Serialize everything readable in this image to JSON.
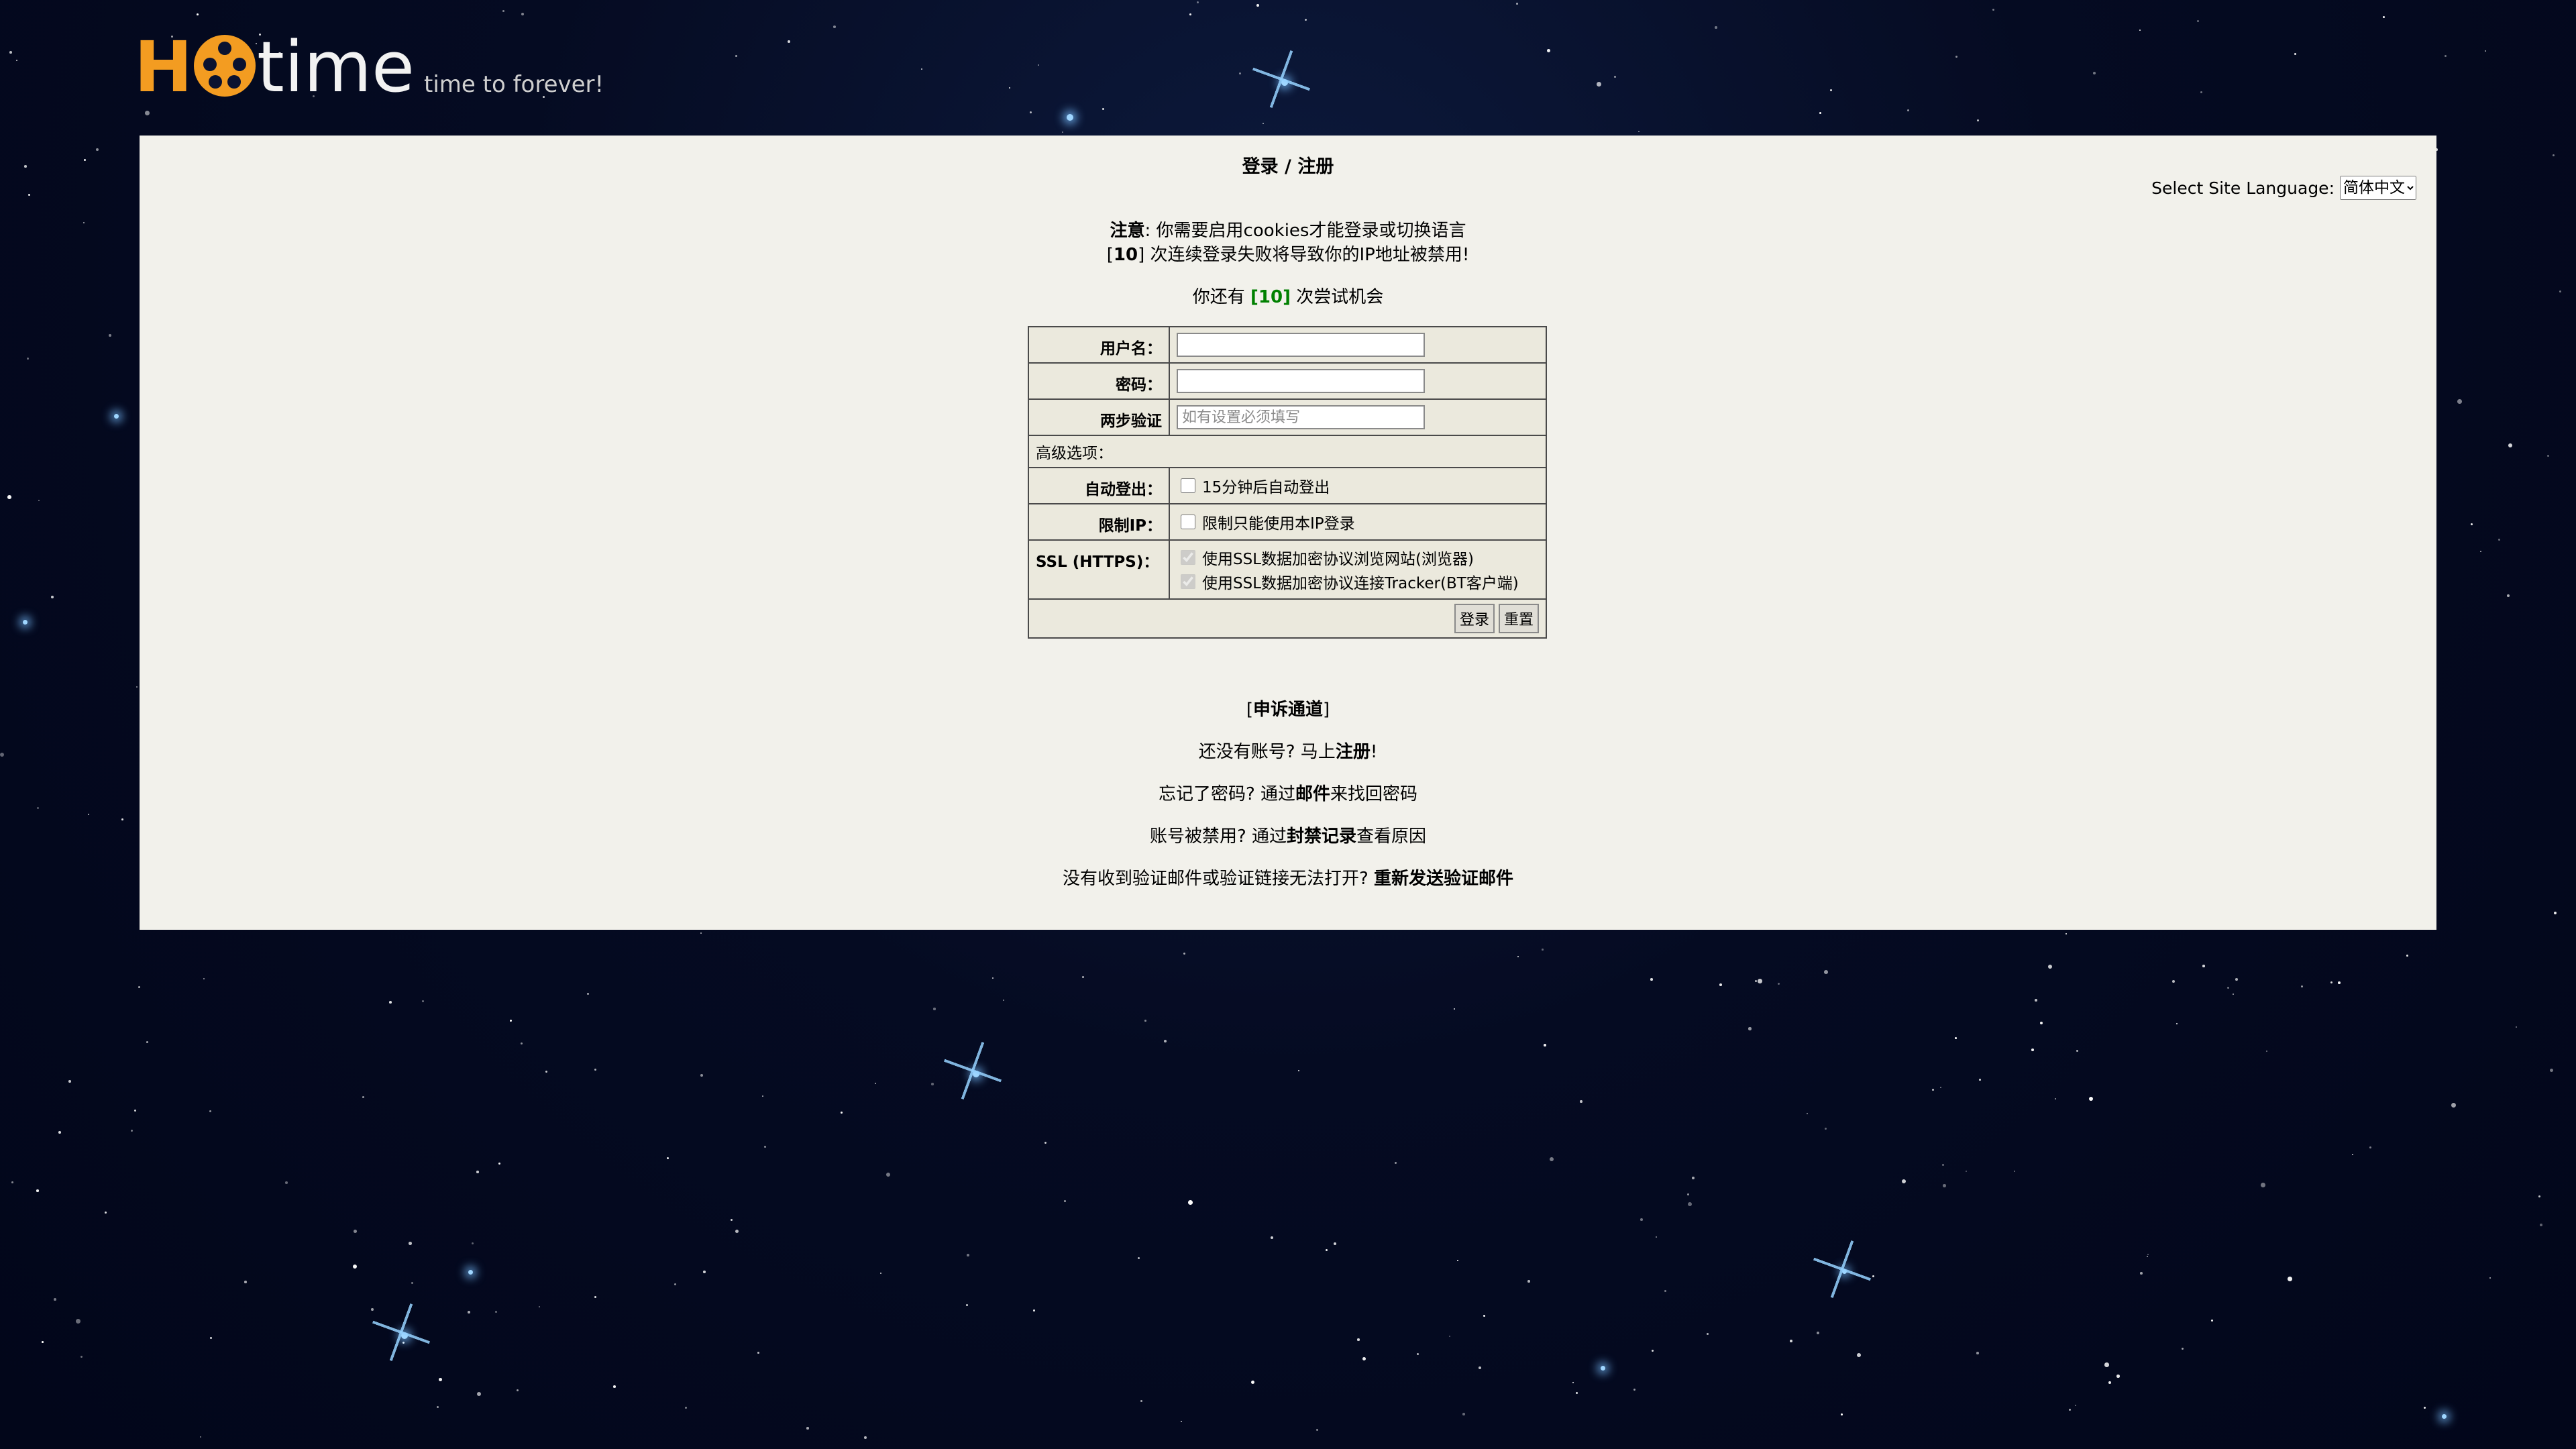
{
  "logo": {
    "letter": "H",
    "word": "time",
    "slogan": "time to forever!"
  },
  "panel": {
    "title": "登录 / 注册",
    "language": {
      "label": "Select Site Language:",
      "selected": "简体中文"
    },
    "notice": {
      "label": "注意",
      "line1": ": 你需要启用cookies才能登录或切换语言",
      "line2_count": "10",
      "line2_text": "次连续登录失败将导致你的IP地址被禁用!"
    },
    "tries": {
      "prefix": "你还有",
      "count": "[10]",
      "suffix": "次尝试机会"
    }
  },
  "form": {
    "username_label": "用户名：",
    "password_label": "密码：",
    "twofa_label": "两步验证",
    "twofa_placeholder": "如有设置必须填写",
    "advanced_label": "高级选项：",
    "autologout_label": "自动登出：",
    "autologout_option": "15分钟后自动登出",
    "restrictip_label": "限制IP：",
    "restrictip_option": "限制只能使用本IP登录",
    "ssl_label": "SSL (HTTPS)：",
    "ssl_option1": "使用SSL数据加密协议浏览网站(浏览器)",
    "ssl_option2": "使用SSL数据加密协议连接Tracker(BT客户端)",
    "login_button": "登录",
    "reset_button": "重置"
  },
  "links": {
    "appeal": "申诉通道",
    "signup_prefix": "还没有账号? 马上",
    "signup_link": "注册",
    "signup_suffix": "!",
    "forgot_prefix": "忘记了密码? 通过",
    "forgot_link": "邮件",
    "forgot_suffix": "来找回密码",
    "banned_prefix": "账号被禁用? 通过",
    "banned_link": "封禁记录",
    "banned_suffix": "查看原因",
    "resend_prefix": "没有收到验证邮件或验证链接无法打开?",
    "resend_link": "重新发送验证邮件"
  },
  "colors": {
    "accent": "#f39c21",
    "panel_bg": "#f2f1eb",
    "highlight_green": "#008000"
  }
}
